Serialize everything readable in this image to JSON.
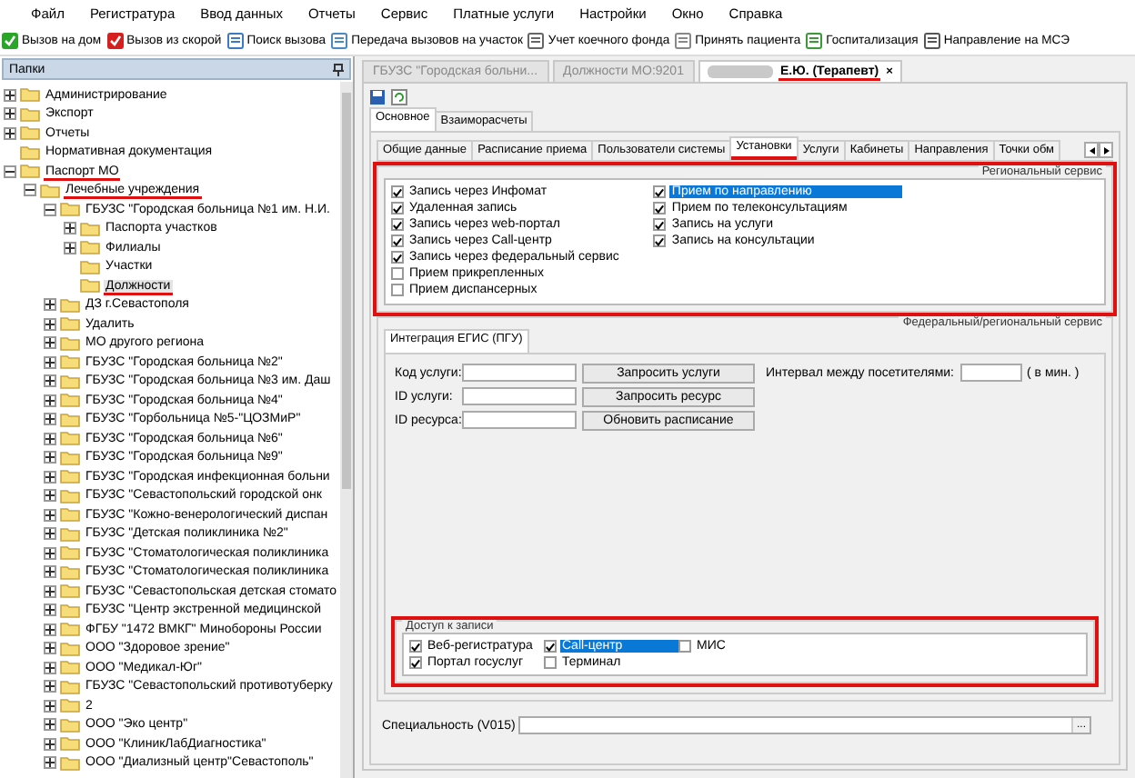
{
  "menu": [
    "Файл",
    "Регистратура",
    "Ввод данных",
    "Отчеты",
    "Сервис",
    "Платные услуги",
    "Настройки",
    "Окно",
    "Справка"
  ],
  "toolbar": [
    "Вызов на дом",
    "Вызов из скорой",
    "Поиск вызова",
    "Передача вызовов на участок",
    "Учет коечного фонда",
    "Принять пациента",
    "Госпитализация",
    "Направление на МСЭ"
  ],
  "folders_panel": {
    "title": "Папки",
    "tree": [
      {
        "label": "Администрирование",
        "expanded": false,
        "selected": false
      },
      {
        "label": "Экспорт",
        "expanded": false,
        "selected": false
      },
      {
        "label": "Отчеты",
        "expanded": false,
        "selected": false
      },
      {
        "label": "Нормативная документация",
        "selected": false
      },
      {
        "label": "Паспорт МО",
        "expanded": true,
        "selected": false,
        "highlighted": true,
        "children": [
          {
            "label": "Лечебные учреждения",
            "expanded": true,
            "selected": false,
            "highlighted": true,
            "children": [
              {
                "label": "ГБУЗС \"Городская больница №1 им. Н.И.",
                "expanded": true,
                "selected": false,
                "children": [
                  {
                    "label": "Паспорта участков",
                    "expanded": false,
                    "selected": false
                  },
                  {
                    "label": "Филиалы",
                    "expanded": false,
                    "selected": false
                  },
                  {
                    "label": "Участки",
                    "selected": false
                  },
                  {
                    "label": "Должности",
                    "selected": true,
                    "highlighted": true
                  }
                ]
              },
              {
                "label": "ДЗ г.Севастополя",
                "expanded": false,
                "selected": false
              },
              {
                "label": "Удалить",
                "expanded": false,
                "selected": false
              },
              {
                "label": "МО другого региона",
                "expanded": false,
                "selected": false
              },
              {
                "label": "ГБУЗС \"Городская больница №2\"",
                "expanded": false,
                "selected": false
              },
              {
                "label": "ГБУЗС \"Городская больница №3 им. Даш",
                "expanded": false,
                "selected": false
              },
              {
                "label": "ГБУЗС \"Городская больница №4\"",
                "expanded": false,
                "selected": false
              },
              {
                "label": "ГБУЗС \"Горбольница №5-\"ЦОЗМиР\"",
                "expanded": false,
                "selected": false
              },
              {
                "label": "ГБУЗС \"Городская больница №6\"",
                "expanded": false,
                "selected": false
              },
              {
                "label": "ГБУЗС \"Городская больница №9\"",
                "expanded": false,
                "selected": false
              },
              {
                "label": "ГБУЗС \"Городская инфекционная больни",
                "expanded": false,
                "selected": false
              },
              {
                "label": "ГБУЗС \"Севастопольский городской онк",
                "expanded": false,
                "selected": false
              },
              {
                "label": "ГБУЗС \"Кожно-венерологический диспан",
                "expanded": false,
                "selected": false
              },
              {
                "label": "ГБУЗС \"Детская поликлиника №2\"",
                "expanded": false,
                "selected": false
              },
              {
                "label": "ГБУЗС \"Стоматологическая поликлиника",
                "expanded": false,
                "selected": false
              },
              {
                "label": "ГБУЗС \"Стоматологическая поликлиника",
                "expanded": false,
                "selected": false
              },
              {
                "label": "ГБУЗС \"Севастопольская детская стомато",
                "expanded": false,
                "selected": false
              },
              {
                "label": "ГБУЗС \"Центр экстренной медицинской",
                "expanded": false,
                "selected": false
              },
              {
                "label": "ФГБУ \"1472 ВМКГ\" Минобороны России",
                "expanded": false,
                "selected": false
              },
              {
                "label": "ООО \"Здоровое зрение\"",
                "expanded": false,
                "selected": false
              },
              {
                "label": "ООО \"Медикал-Юг\"",
                "expanded": false,
                "selected": false
              },
              {
                "label": "ГБУЗС \"Севастопольский противотуберку",
                "expanded": false,
                "selected": false
              },
              {
                "label": "2",
                "expanded": false,
                "selected": false
              },
              {
                "label": "ООО \"Эко центр\"",
                "expanded": false,
                "selected": false
              },
              {
                "label": "ООО \"КлиникЛабДиагностика\"",
                "expanded": false,
                "selected": false
              },
              {
                "label": "ООО \"Диализный центр\"Севастополь\"",
                "expanded": false,
                "selected": false
              }
            ]
          }
        ]
      }
    ]
  },
  "doc_tabs": [
    {
      "label": "ГБУЗС \"Городская больни...",
      "selected": false
    },
    {
      "label": "Должности МО:9201",
      "selected": false
    },
    {
      "label": "Е.Ю. (Терапевт)",
      "selected": true,
      "blurred_prefix": true,
      "highlighted": true,
      "close": "×"
    }
  ],
  "main_tabs": [
    {
      "label": "Основное",
      "selected": true
    },
    {
      "label": "Взаиморасчеты",
      "selected": false
    }
  ],
  "sub_tabs": [
    {
      "label": "Общие данные",
      "selected": false
    },
    {
      "label": "Расписание приема",
      "selected": false
    },
    {
      "label": "Пользователи системы",
      "selected": false
    },
    {
      "label": "Установки",
      "selected": true,
      "highlighted": true
    },
    {
      "label": "Услуги",
      "selected": false
    },
    {
      "label": "Кабинеты",
      "selected": false
    },
    {
      "label": "Направления",
      "selected": false
    },
    {
      "label": "Точки обм",
      "selected": false
    }
  ],
  "regional_service": {
    "title": "Региональный сервис",
    "highlighted": true,
    "columns": [
      [
        {
          "label": "Запись через Инфомат",
          "checked": true,
          "selected": false
        },
        {
          "label": "Удаленная запись",
          "checked": true,
          "selected": false
        },
        {
          "label": "Запись через web-портал",
          "checked": true,
          "selected": false
        },
        {
          "label": "Запись через Call-центр",
          "checked": true,
          "selected": false
        },
        {
          "label": "Запись через федеральный сервис",
          "checked": true,
          "selected": false
        },
        {
          "label": "Прием прикрепленных",
          "checked": false,
          "selected": false
        },
        {
          "label": "Прием диспансерных",
          "checked": false,
          "selected": false
        }
      ],
      [
        {
          "label": "Прием по направлению",
          "checked": true,
          "selected": true
        },
        {
          "label": "Прием по телеконсультациям",
          "checked": true,
          "selected": false
        },
        {
          "label": "Запись на услуги",
          "checked": true,
          "selected": false
        },
        {
          "label": "Запись на консультации",
          "checked": true,
          "selected": false
        }
      ]
    ]
  },
  "federal_service": {
    "title": "Федеральный/региональный сервис",
    "tab": {
      "label": "Интеграция ЕГИС (ПГУ)",
      "selected": true
    },
    "fields": [
      {
        "label": "Код услуги:",
        "button": "Запросить услуги"
      },
      {
        "label": "ID услуги:",
        "button": "Запросить ресурс"
      },
      {
        "label": "ID ресурса:",
        "button": "Обновить расписание"
      }
    ],
    "interval": {
      "label": "Интервал между посетителями:",
      "unit": "( в мин. )"
    },
    "access": {
      "title": "Доступ к записи",
      "highlighted": true,
      "items": [
        {
          "label": "Веб-регистратура",
          "checked": true,
          "selected": false
        },
        {
          "label": "Портал госуслуг",
          "checked": true,
          "selected": false
        },
        {
          "label": "Call-центр",
          "checked": true,
          "selected": true
        },
        {
          "label": "Терминал",
          "checked": false,
          "selected": false
        },
        {
          "label": "МИС",
          "checked": false,
          "selected": false
        }
      ]
    }
  },
  "specialty": {
    "label": "Специальность (V015)",
    "button": "..."
  }
}
